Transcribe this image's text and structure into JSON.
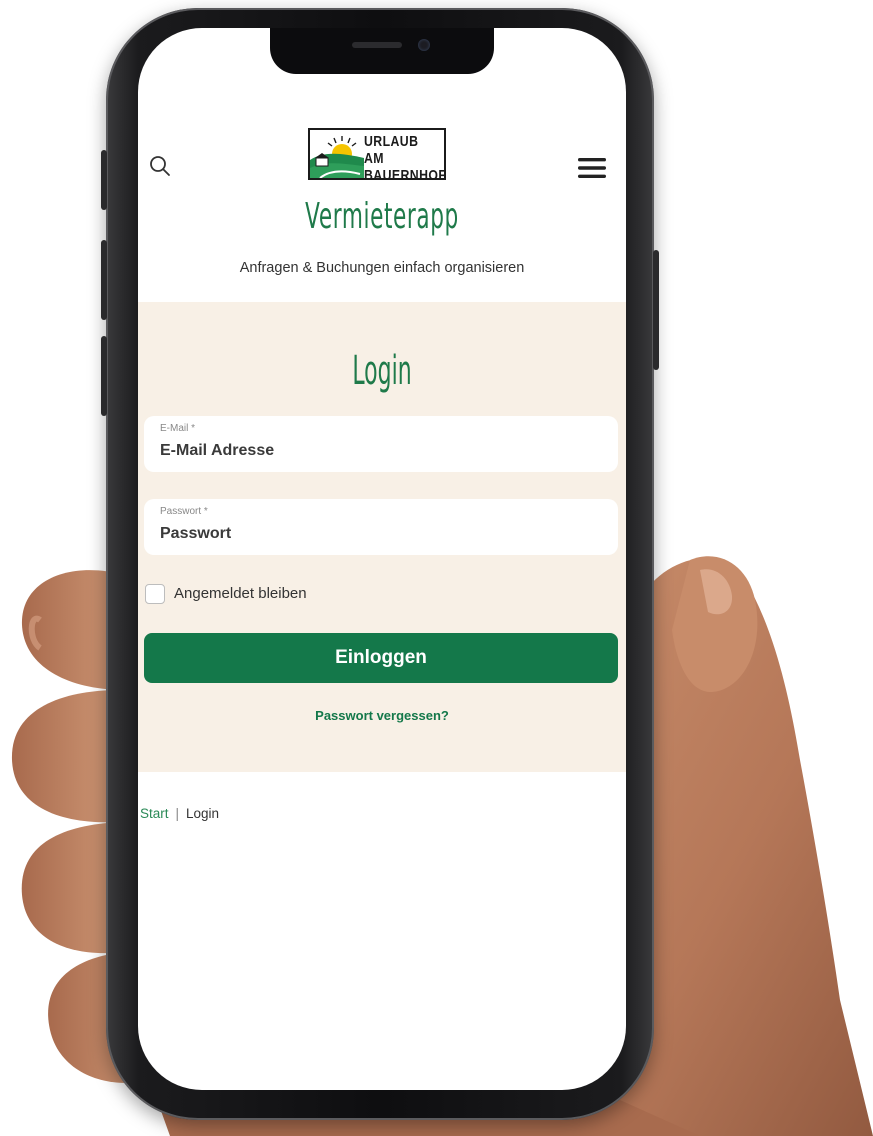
{
  "header": {
    "logo_line1": "URLAUB AM",
    "logo_line2": "BAUERNHOF",
    "app_title": "Vermieterapp",
    "subtitle": "Anfragen & Buchungen einfach organisieren"
  },
  "login": {
    "title": "Login",
    "email": {
      "label": "E-Mail *",
      "placeholder": "E-Mail Adresse",
      "value": ""
    },
    "password": {
      "label": "Passwort *",
      "placeholder": "Passwort",
      "value": ""
    },
    "remember_label": "Angemeldet bleiben",
    "remember_checked": false,
    "submit_label": "Einloggen",
    "forgot_label": "Passwort vergessen?"
  },
  "breadcrumb": {
    "items": [
      "Start",
      "Login"
    ],
    "separator": "|"
  },
  "colors": {
    "brand_green": "#14784a",
    "panel_bg": "#f8f0e6"
  },
  "icons": {
    "search": "search-icon",
    "menu": "hamburger-menu-icon"
  }
}
